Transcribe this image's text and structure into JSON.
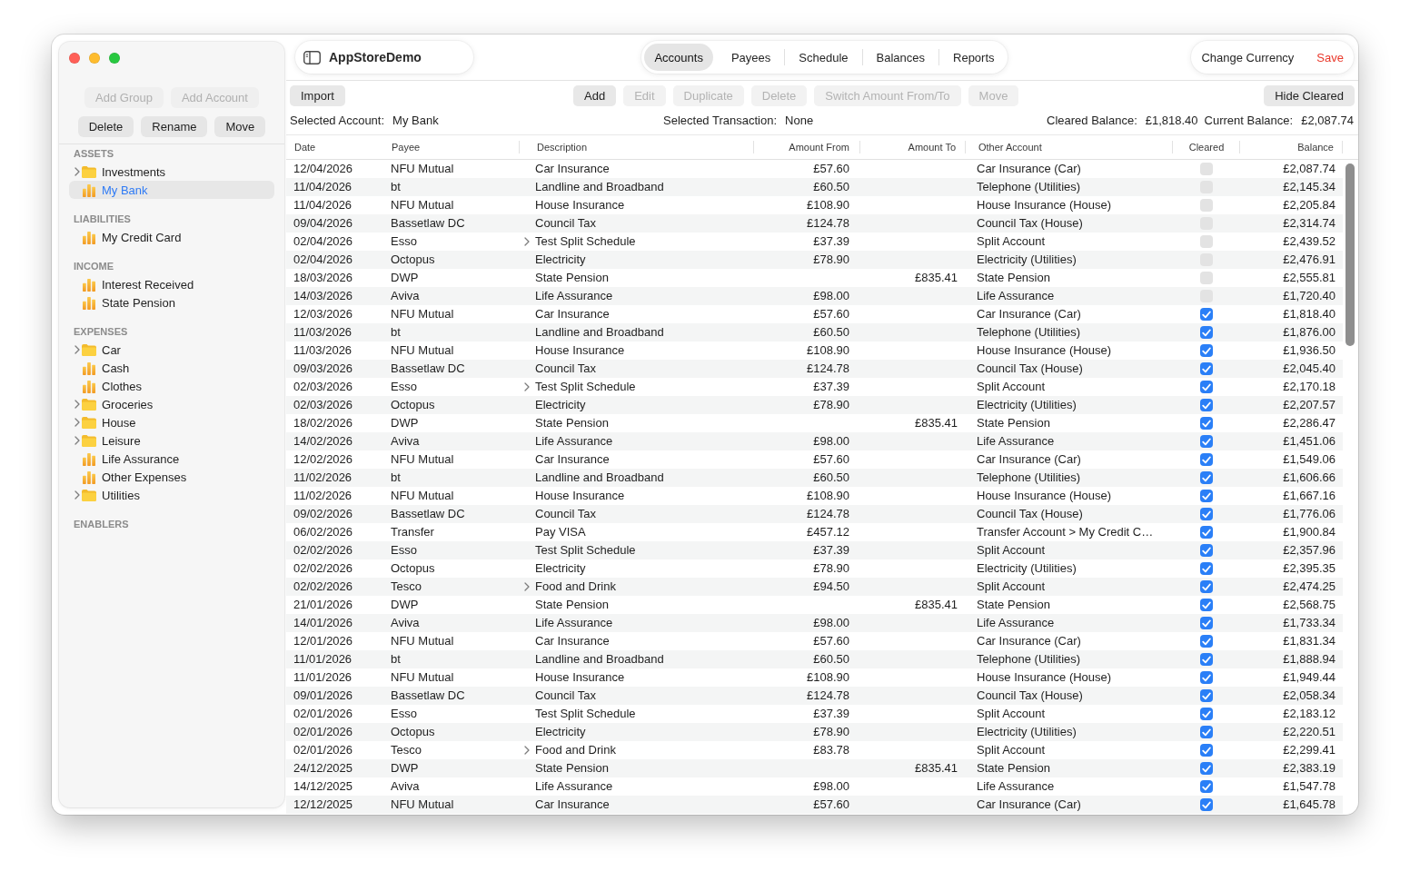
{
  "sidebar": {
    "button_rows": [
      [
        {
          "label": "Add Group",
          "disabled": true
        },
        {
          "label": "Add Account",
          "disabled": true
        }
      ],
      [
        {
          "label": "Delete",
          "disabled": false
        },
        {
          "label": "Rename",
          "disabled": false
        },
        {
          "label": "Move",
          "disabled": false
        }
      ]
    ],
    "sections": [
      {
        "title": "ASSETS",
        "items": [
          {
            "label": "Investments",
            "kind": "group",
            "expanded": false,
            "selected": false
          },
          {
            "label": "My Bank",
            "kind": "account",
            "selected": true
          }
        ]
      },
      {
        "title": "LIABILITIES",
        "items": [
          {
            "label": "My Credit Card",
            "kind": "account",
            "selected": false
          }
        ]
      },
      {
        "title": "INCOME",
        "items": [
          {
            "label": "Interest Received",
            "kind": "account",
            "selected": false
          },
          {
            "label": "State Pension",
            "kind": "account",
            "selected": false
          }
        ]
      },
      {
        "title": "EXPENSES",
        "items": [
          {
            "label": "Car",
            "kind": "group",
            "expanded": false,
            "selected": false
          },
          {
            "label": "Cash",
            "kind": "account",
            "selected": false
          },
          {
            "label": "Clothes",
            "kind": "account",
            "selected": false
          },
          {
            "label": "Groceries",
            "kind": "group",
            "expanded": false,
            "selected": false
          },
          {
            "label": "House",
            "kind": "group",
            "expanded": false,
            "selected": false
          },
          {
            "label": "Leisure",
            "kind": "group",
            "expanded": false,
            "selected": false
          },
          {
            "label": "Life Assurance",
            "kind": "account",
            "selected": false
          },
          {
            "label": "Other Expenses",
            "kind": "account",
            "selected": false
          },
          {
            "label": "Utilities",
            "kind": "group",
            "expanded": false,
            "selected": false
          }
        ]
      },
      {
        "title": "ENABLERS"
      }
    ]
  },
  "title_bar": {
    "title": "AppStoreDemo"
  },
  "tabs": [
    {
      "label": "Accounts",
      "selected": true
    },
    {
      "label": "Payees",
      "selected": false
    },
    {
      "label": "Schedule",
      "selected": false
    },
    {
      "label": "Balances",
      "selected": false
    },
    {
      "label": "Reports",
      "selected": false
    }
  ],
  "actions": [
    {
      "label": "Change Currency",
      "kind": "plain"
    },
    {
      "label": "Save",
      "kind": "accent"
    }
  ],
  "toolbar": {
    "file_buttons": [
      {
        "label": "Import",
        "disabled": false
      }
    ],
    "transaction_buttons": [
      {
        "label": "Add",
        "disabled": false
      },
      {
        "label": "Edit",
        "disabled": true
      },
      {
        "label": "Duplicate",
        "disabled": true
      },
      {
        "label": "Delete",
        "disabled": true
      },
      {
        "label": "Switch Amount From/To",
        "disabled": true
      },
      {
        "label": "Move",
        "disabled": true
      }
    ],
    "view_buttons": [
      {
        "label": "Hide Cleared",
        "disabled": false
      }
    ]
  },
  "info_bar": [
    {
      "label": "Selected Account:",
      "value": "My Bank"
    },
    {
      "label": "Selected Transaction:",
      "value": "None"
    },
    {
      "label": "Cleared Balance:",
      "value": "£1,818.40"
    },
    {
      "label": "Current Balance:",
      "value": "£2,087.74"
    }
  ],
  "table": {
    "columns": [
      "Date",
      "Payee",
      "Description",
      "Amount From",
      "Amount To",
      "Other Account",
      "Cleared",
      "Balance"
    ],
    "rows": [
      {
        "date": "12/04/2026",
        "payee": "NFU Mutual",
        "description": "Car Insurance",
        "expandable": false,
        "amount_from": "£57.60",
        "other_account": "Car Insurance (Car)",
        "cleared": false,
        "balance": "£2,087.74"
      },
      {
        "date": "11/04/2026",
        "payee": "bt",
        "description": "Landline and Broadband",
        "expandable": false,
        "amount_from": "£60.50",
        "other_account": "Telephone (Utilities)",
        "cleared": false,
        "balance": "£2,145.34"
      },
      {
        "date": "11/04/2026",
        "payee": "NFU Mutual",
        "description": "House Insurance",
        "expandable": false,
        "amount_from": "£108.90",
        "other_account": "House Insurance (House)",
        "cleared": false,
        "balance": "£2,205.84"
      },
      {
        "date": "09/04/2026",
        "payee": "Bassetlaw DC",
        "description": "Council Tax",
        "expandable": false,
        "amount_from": "£124.78",
        "other_account": "Council Tax (House)",
        "cleared": false,
        "balance": "£2,314.74"
      },
      {
        "date": "02/04/2026",
        "payee": "Esso",
        "description": "Test Split Schedule",
        "expandable": true,
        "amount_from": "£37.39",
        "other_account": "Split Account",
        "cleared": false,
        "balance": "£2,439.52"
      },
      {
        "date": "02/04/2026",
        "payee": "Octopus",
        "description": "Electricity",
        "expandable": false,
        "amount_from": "£78.90",
        "other_account": "Electricity (Utilities)",
        "cleared": false,
        "balance": "£2,476.91"
      },
      {
        "date": "18/03/2026",
        "payee": "DWP",
        "description": "State Pension",
        "expandable": false,
        "amount_to": "£835.41",
        "other_account": "State Pension",
        "cleared": false,
        "balance": "£2,555.81"
      },
      {
        "date": "14/03/2026",
        "payee": "Aviva",
        "description": "Life Assurance",
        "expandable": false,
        "amount_from": "£98.00",
        "other_account": "Life Assurance",
        "cleared": false,
        "balance": "£1,720.40"
      },
      {
        "date": "12/03/2026",
        "payee": "NFU Mutual",
        "description": "Car Insurance",
        "expandable": false,
        "amount_from": "£57.60",
        "other_account": "Car Insurance (Car)",
        "cleared": true,
        "balance": "£1,818.40"
      },
      {
        "date": "11/03/2026",
        "payee": "bt",
        "description": "Landline and Broadband",
        "expandable": false,
        "amount_from": "£60.50",
        "other_account": "Telephone (Utilities)",
        "cleared": true,
        "balance": "£1,876.00"
      },
      {
        "date": "11/03/2026",
        "payee": "NFU Mutual",
        "description": "House Insurance",
        "expandable": false,
        "amount_from": "£108.90",
        "other_account": "House Insurance (House)",
        "cleared": true,
        "balance": "£1,936.50"
      },
      {
        "date": "09/03/2026",
        "payee": "Bassetlaw DC",
        "description": "Council Tax",
        "expandable": false,
        "amount_from": "£124.78",
        "other_account": "Council Tax (House)",
        "cleared": true,
        "balance": "£2,045.40"
      },
      {
        "date": "02/03/2026",
        "payee": "Esso",
        "description": "Test Split Schedule",
        "expandable": true,
        "amount_from": "£37.39",
        "other_account": "Split Account",
        "cleared": true,
        "balance": "£2,170.18"
      },
      {
        "date": "02/03/2026",
        "payee": "Octopus",
        "description": "Electricity",
        "expandable": false,
        "amount_from": "£78.90",
        "other_account": "Electricity (Utilities)",
        "cleared": true,
        "balance": "£2,207.57"
      },
      {
        "date": "18/02/2026",
        "payee": "DWP",
        "description": "State Pension",
        "expandable": false,
        "amount_to": "£835.41",
        "other_account": "State Pension",
        "cleared": true,
        "balance": "£2,286.47"
      },
      {
        "date": "14/02/2026",
        "payee": "Aviva",
        "description": "Life Assurance",
        "expandable": false,
        "amount_from": "£98.00",
        "other_account": "Life Assurance",
        "cleared": true,
        "balance": "£1,451.06"
      },
      {
        "date": "12/02/2026",
        "payee": "NFU Mutual",
        "description": "Car Insurance",
        "expandable": false,
        "amount_from": "£57.60",
        "other_account": "Car Insurance (Car)",
        "cleared": true,
        "balance": "£1,549.06"
      },
      {
        "date": "11/02/2026",
        "payee": "bt",
        "description": "Landline and Broadband",
        "expandable": false,
        "amount_from": "£60.50",
        "other_account": "Telephone (Utilities)",
        "cleared": true,
        "balance": "£1,606.66"
      },
      {
        "date": "11/02/2026",
        "payee": "NFU Mutual",
        "description": "House Insurance",
        "expandable": false,
        "amount_from": "£108.90",
        "other_account": "House Insurance (House)",
        "cleared": true,
        "balance": "£1,667.16"
      },
      {
        "date": "09/02/2026",
        "payee": "Bassetlaw DC",
        "description": "Council Tax",
        "expandable": false,
        "amount_from": "£124.78",
        "other_account": "Council Tax (House)",
        "cleared": true,
        "balance": "£1,776.06"
      },
      {
        "date": "06/02/2026",
        "payee": "Transfer",
        "description": "Pay VISA",
        "expandable": false,
        "amount_from": "£457.12",
        "other_account": "Transfer Account > My Credit C…",
        "cleared": true,
        "balance": "£1,900.84"
      },
      {
        "date": "02/02/2026",
        "payee": "Esso",
        "description": "Test Split Schedule",
        "expandable": false,
        "amount_from": "£37.39",
        "other_account": "Split Account",
        "cleared": true,
        "balance": "£2,357.96"
      },
      {
        "date": "02/02/2026",
        "payee": "Octopus",
        "description": "Electricity",
        "expandable": false,
        "amount_from": "£78.90",
        "other_account": "Electricity (Utilities)",
        "cleared": true,
        "balance": "£2,395.35"
      },
      {
        "date": "02/02/2026",
        "payee": "Tesco",
        "description": "Food and Drink",
        "expandable": true,
        "amount_from": "£94.50",
        "other_account": "Split Account",
        "cleared": true,
        "balance": "£2,474.25"
      },
      {
        "date": "21/01/2026",
        "payee": "DWP",
        "description": "State Pension",
        "expandable": false,
        "amount_to": "£835.41",
        "other_account": "State Pension",
        "cleared": true,
        "balance": "£2,568.75"
      },
      {
        "date": "14/01/2026",
        "payee": "Aviva",
        "description": "Life Assurance",
        "expandable": false,
        "amount_from": "£98.00",
        "other_account": "Life Assurance",
        "cleared": true,
        "balance": "£1,733.34"
      },
      {
        "date": "12/01/2026",
        "payee": "NFU Mutual",
        "description": "Car Insurance",
        "expandable": false,
        "amount_from": "£57.60",
        "other_account": "Car Insurance (Car)",
        "cleared": true,
        "balance": "£1,831.34"
      },
      {
        "date": "11/01/2026",
        "payee": "bt",
        "description": "Landline and Broadband",
        "expandable": false,
        "amount_from": "£60.50",
        "other_account": "Telephone (Utilities)",
        "cleared": true,
        "balance": "£1,888.94"
      },
      {
        "date": "11/01/2026",
        "payee": "NFU Mutual",
        "description": "House Insurance",
        "expandable": false,
        "amount_from": "£108.90",
        "other_account": "House Insurance (House)",
        "cleared": true,
        "balance": "£1,949.44"
      },
      {
        "date": "09/01/2026",
        "payee": "Bassetlaw DC",
        "description": "Council Tax",
        "expandable": false,
        "amount_from": "£124.78",
        "other_account": "Council Tax (House)",
        "cleared": true,
        "balance": "£2,058.34"
      },
      {
        "date": "02/01/2026",
        "payee": "Esso",
        "description": "Test Split Schedule",
        "expandable": false,
        "amount_from": "£37.39",
        "other_account": "Split Account",
        "cleared": true,
        "balance": "£2,183.12"
      },
      {
        "date": "02/01/2026",
        "payee": "Octopus",
        "description": "Electricity",
        "expandable": false,
        "amount_from": "£78.90",
        "other_account": "Electricity (Utilities)",
        "cleared": true,
        "balance": "£2,220.51"
      },
      {
        "date": "02/01/2026",
        "payee": "Tesco",
        "description": "Food and Drink",
        "expandable": true,
        "amount_from": "£83.78",
        "other_account": "Split Account",
        "cleared": true,
        "balance": "£2,299.41"
      },
      {
        "date": "24/12/2025",
        "payee": "DWP",
        "description": "State Pension",
        "expandable": false,
        "amount_to": "£835.41",
        "other_account": "State Pension",
        "cleared": true,
        "balance": "£2,383.19"
      },
      {
        "date": "14/12/2025",
        "payee": "Aviva",
        "description": "Life Assurance",
        "expandable": false,
        "amount_from": "£98.00",
        "other_account": "Life Assurance",
        "cleared": true,
        "balance": "£1,547.78"
      },
      {
        "date": "12/12/2025",
        "payee": "NFU Mutual",
        "description": "Car Insurance",
        "expandable": false,
        "amount_from": "£57.60",
        "other_account": "Car Insurance (Car)",
        "cleared": true,
        "balance": "£1,645.78"
      }
    ]
  }
}
